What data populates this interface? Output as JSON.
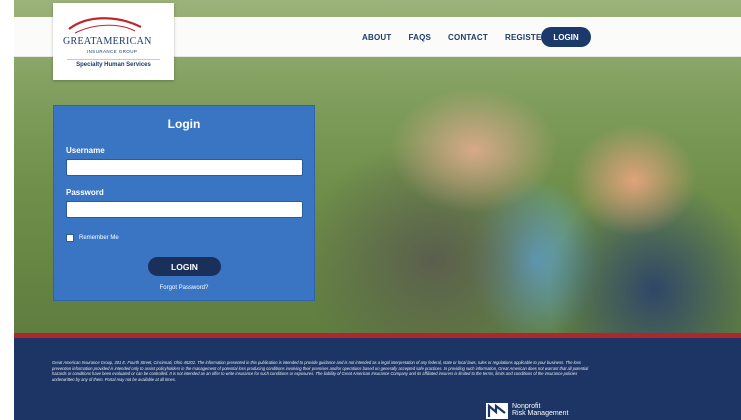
{
  "nav": {
    "links": [
      "ABOUT",
      "FAQS",
      "CONTACT",
      "REGISTER"
    ],
    "login_label": "LOGIN"
  },
  "logo": {
    "main": "GREATAMERICAN",
    "sub": "INSURANCE GROUP",
    "tagline": "Specialty Human Services"
  },
  "login": {
    "title": "Login",
    "username_label": "Username",
    "username_value": "",
    "password_label": "Password",
    "password_value": "",
    "remember_label": "Remember Me",
    "button_label": "LOGIN",
    "forgot_label": "Forgot Password?"
  },
  "footer": {
    "disclaimer": "Great American Insurance Group, 301 E. Fourth Street, Cincinnati, Ohio 45202. The information presented in this publication is intended to provide guidance and is not intended as a legal interpretation of any federal, state or local laws, rules or regulations applicable to your business. The loss prevention information provided is intended only to assist policyholders in the management of potential loss producing conditions involving their premises and/or operations based on generally accepted safe practices. In providing such information, Great American does not warrant that all potential hazards or conditions have been evaluated or can be controlled. It is not intended as an offer to write insurance for such conditions or exposures. The liability of Great American Insurance Company and its affiliated insurers is limited to the terms, limits and conditions of the insurance policies underwritten by any of them. Portal may not be available at all times.",
    "partner_line1": "Nonprofit",
    "partner_line2": "Risk Management"
  },
  "colors": {
    "navy": "#1b3a6b",
    "panel_blue": "#3a75c4",
    "footer_navy": "#1c3564",
    "accent_red": "#b0262c"
  }
}
